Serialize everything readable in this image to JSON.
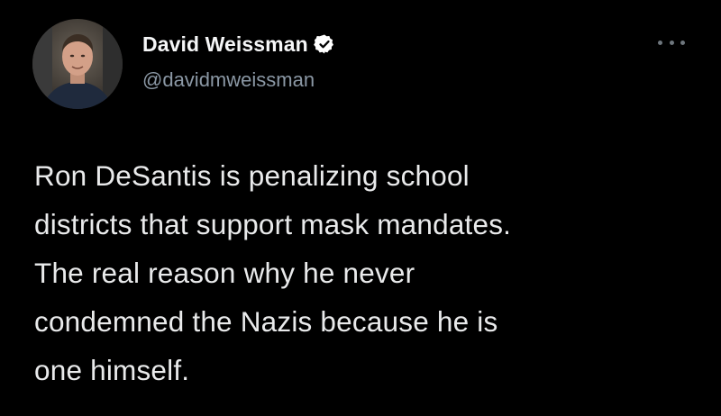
{
  "tweet": {
    "author": {
      "display_name": "David Weissman",
      "handle": "@davidmweissman",
      "verified": true,
      "avatar_icon": "profile-photo"
    },
    "more_icon": "ellipsis-icon",
    "text_lines": [
      "Ron DeSantis is penalizing school",
      "districts that support mask mandates.",
      "The real reason why he never",
      "condemned the Nazis because he is",
      "one himself."
    ]
  },
  "colors": {
    "background": "#000000",
    "text": "#e7e9ea",
    "secondary_text": "#8b98a5",
    "verified_badge": "#ffffff"
  }
}
